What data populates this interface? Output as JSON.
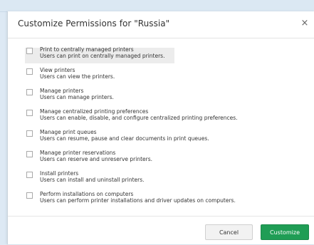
{
  "dialog": {
    "title": "Customize Permissions for \"Russia\"",
    "close_icon": "close-icon",
    "close_glyph": "×"
  },
  "permissions": [
    {
      "label": "Print to centrally managed printers",
      "description": "Users can print on centrally managed printers.",
      "checked": false,
      "highlighted": true
    },
    {
      "label": "View printers",
      "description": "Users can view the printers.",
      "checked": false
    },
    {
      "label": "Manage printers",
      "description": "Users can manage printers.",
      "checked": false
    },
    {
      "label": "Manage centralized printing preferences",
      "description": "Users can enable, disable, and configure centralized printing preferences.",
      "checked": false
    },
    {
      "label": "Manage print queues",
      "description": "Users can resume, pause and clear documents in print queues.",
      "checked": false
    },
    {
      "label": "Manage printer reservations",
      "description": "Users can reserve and unreserve printers.",
      "checked": false
    },
    {
      "label": "Install printers",
      "description": "Users can install and uninstall printers.",
      "checked": false
    },
    {
      "label": "Perform installations on computers",
      "description": "Users can perform printer installations and driver updates on computers.",
      "checked": false
    }
  ],
  "footer": {
    "cancel_label": "Cancel",
    "customize_label": "Customize"
  },
  "colors": {
    "primary": "#1f9d55",
    "backdrop": "#dde9f4"
  }
}
